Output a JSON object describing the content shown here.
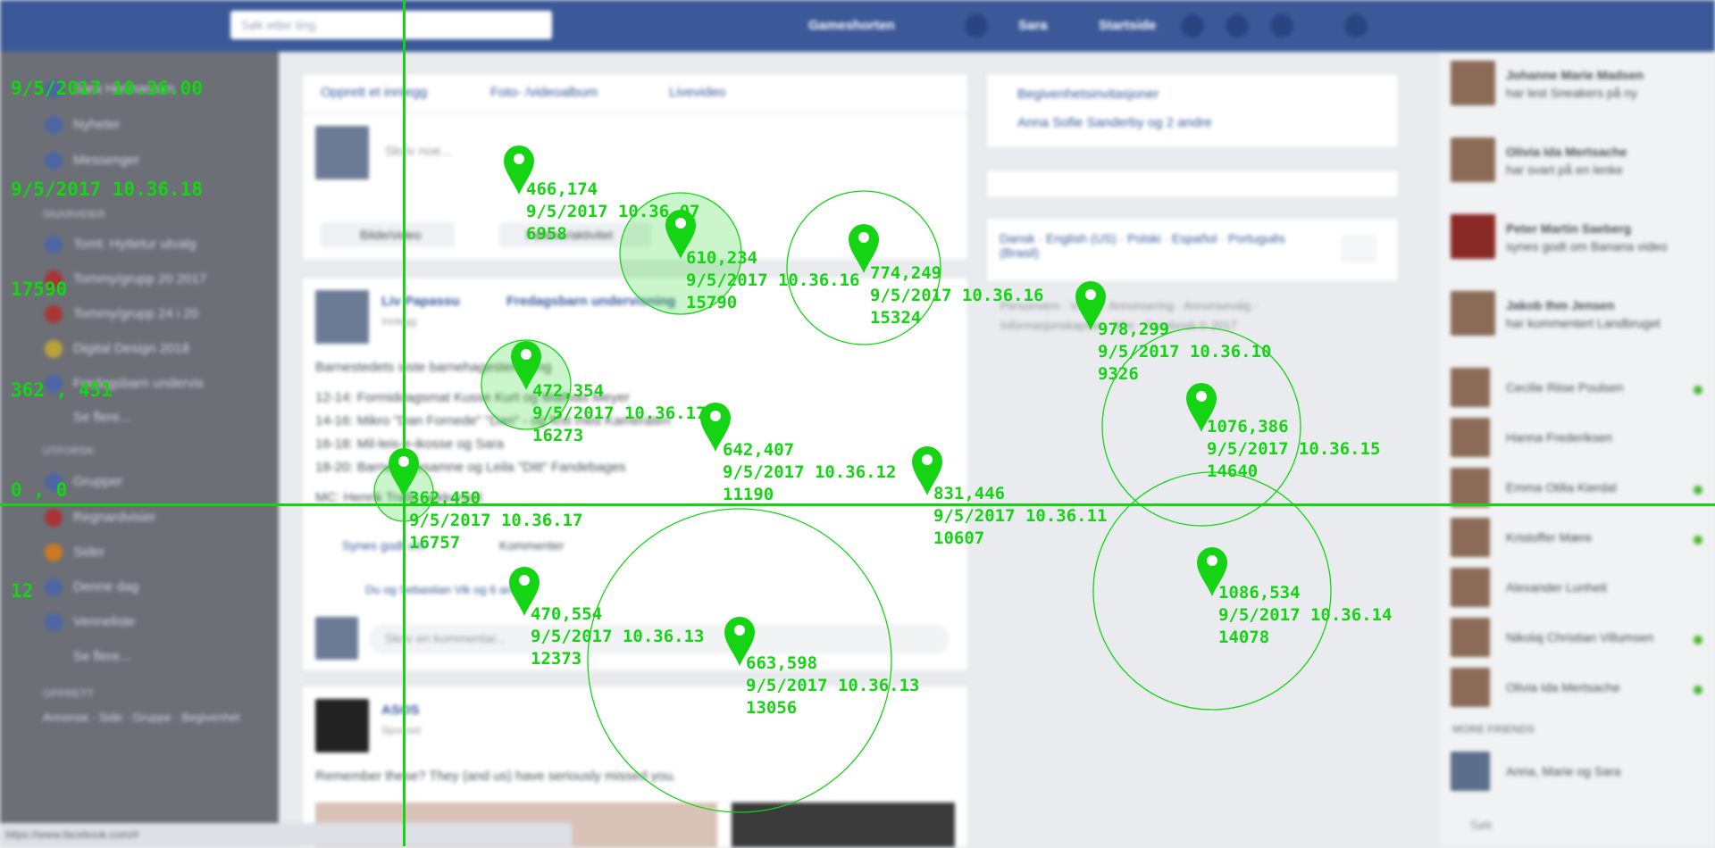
{
  "browser": {
    "status_url": "https://www.facebook.com/#"
  },
  "topbar": {
    "search_placeholder": "Søk etter ting",
    "nav": [
      "Gameshorten",
      "Sara",
      "Startside"
    ]
  },
  "left_panel": {
    "items_top": [
      "Sara Hermansen",
      "Nyheter",
      "Messenger"
    ],
    "section_groups": "SNARVEIER",
    "shortcuts": [
      "Tomt: Hyttetur utvalg",
      "Tommy/grupp 20 2017",
      "Tommy/grupp 24 i 20",
      "Digital Design 2018",
      "Fredagsbarn undervis",
      "Se flere..."
    ],
    "section_explore": "UTFORSK",
    "explore": [
      "Grupper",
      "Regnardvisier",
      "Sider",
      "Denne dag",
      "Venneliste",
      "Se flere..."
    ],
    "section_create": "OPPRETT",
    "create_links": "Annonse · Side · Gruppe · Begivenhet"
  },
  "composer": {
    "tabs": [
      "Opprett et innlegg",
      "Foto- /videoalbum",
      "Livevideo"
    ],
    "prompt": "Skriv noe...",
    "actions": [
      "Bilde/video",
      "Følelse/aktivitet"
    ]
  },
  "post": {
    "author": "Liv Papassu",
    "group": "Fredagsbarn undervisning",
    "meta": "Innlegg",
    "lines": [
      "Barnestedets siste barnehagestemming",
      "12-14: Formiddagsmat Kusse Kurt og Mathias Meyer",
      "14-16: Mikro \"Dan Fornede\" \"Dan\" - og fest med Kameraten",
      "16-18: Mil-leis-e-ikosse og Sara",
      "18-20: Barnetredesamne og Leila \"Ditt\" Fandebages",
      "MC: Henrik Tralle sekkunkel"
    ],
    "like": "Synes godt om",
    "comment": "Kommenter",
    "liked_by": "Du og Sebastian Vik og 6 andre",
    "comment_placeholder": "Skriv en kommentar..."
  },
  "ad": {
    "name": "ASOS",
    "meta": "Sponset",
    "text": "Remember these? They (and us) have seriously missed you."
  },
  "middle_column": {
    "events": [
      "Begivenhetsinvitasjoner",
      "Anna Sofie Sanderby og 2 andre"
    ],
    "languages": "Dansk · English (US) · Polski · Español · Português (Brasil)",
    "footer": "Personvern · Vilkår · Annonsering · Annonsevalg · Informasjonskapsler · Mer · Facebook © 2017"
  },
  "right_panel": {
    "ticker": [
      {
        "name": "Johanne Marie Madsen",
        "text": "har lest Sneakers på ny"
      },
      {
        "name": "Olivia Ida Mertsache",
        "text": "har svart på en lenke"
      },
      {
        "name": "Peter Martin Saeberg",
        "text": "synes godt om Banana video"
      },
      {
        "name": "Jakob Ihm Jensen",
        "text": "har kommentert Landbruget"
      }
    ],
    "contacts": [
      "Cecilie Riise Poulsen",
      "Hanna Frederiksen",
      "Emma Otilia Kierdal",
      "Kristoffer Mære",
      "Alexander Lunheit",
      "Nikolaj Christian Villumsen",
      "Olivia Ida Mertsache"
    ],
    "more_friends": "MORE FRIENDS",
    "group_chat": "Anna, Marie og Sara",
    "search_placeholder": "Søk"
  },
  "overlay": {
    "color": "#14d414",
    "hud": [
      "9/5/2017 10.36.00",
      "9/5/2017 10.36.18",
      "17590",
      "362 , 451",
      "0 , 0",
      "12"
    ],
    "pins": [
      {
        "label": "466,174\n9/5/2017 10.36.07\n6958",
        "dwell": 0
      },
      {
        "label": "610,234\n9/5/2017 10.36.16\n15790",
        "dwell": 1
      },
      {
        "label": "774,249\n9/5/2017 10.36.16\n15324",
        "dwell": 1
      },
      {
        "label": "978,299\n9/5/2017 10.36.10\n9326",
        "dwell": 0
      },
      {
        "label": "472,354\n9/5/2017 10.36.17\n16273",
        "dwell": 1
      },
      {
        "label": "642,407\n9/5/2017 10.36.12\n11190",
        "dwell": 0
      },
      {
        "label": "1076,386\n9/5/2017 10.36.15\n14640",
        "dwell": 1
      },
      {
        "label": "362,450\n9/5/2017 10.36.17\n16757",
        "dwell": 1
      },
      {
        "label": "831,446\n9/5/2017 10.36.11\n10607",
        "dwell": 0
      },
      {
        "label": "470,554\n9/5/2017 10.36.13\n12373",
        "dwell": 0
      },
      {
        "label": "1086,534\n9/5/2017 10.36.14\n14078",
        "dwell": 1
      },
      {
        "label": "663,598\n9/5/2017 10.36.13\n13056",
        "dwell": 1
      }
    ]
  }
}
